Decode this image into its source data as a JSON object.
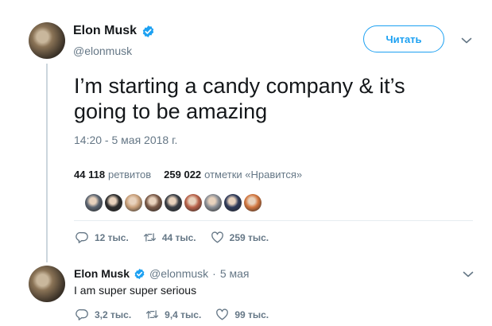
{
  "tweet": {
    "display_name": "Elon Musk",
    "handle": "@elonmusk",
    "follow_label": "Читать",
    "text": "I’m starting a candy company & it’s going to be amazing",
    "timestamp": "14:20 - 5 мая 2018 г.",
    "retweets_count": "44 118",
    "retweets_label": "ретвитов",
    "likes_count": "259 022",
    "likes_label": "отметки «Нравится»",
    "liker_colors": [
      "#5b6470",
      "#2e2e2e",
      "#c9a07a",
      "#7a5a48",
      "#3a3f46",
      "#b8624a",
      "#8b8f96",
      "#2f3b5a",
      "#d2763f"
    ],
    "actions": {
      "replies": "12 тыс.",
      "retweets": "44 тыс.",
      "likes": "259 тыс."
    }
  },
  "reply": {
    "display_name": "Elon Musk",
    "handle": "@elonmusk",
    "separator": "·",
    "date": "5 мая",
    "text": "I am super super serious",
    "actions": {
      "replies": "3,2 тыс.",
      "retweets": "9,4 тыс.",
      "likes": "99 тыс."
    }
  },
  "colors": {
    "accent": "#1da1f2",
    "muted": "#657786",
    "text": "#14171a"
  },
  "icons": [
    "verified-badge-icon",
    "chevron-down-icon",
    "reply-icon",
    "retweet-icon",
    "like-icon"
  ]
}
